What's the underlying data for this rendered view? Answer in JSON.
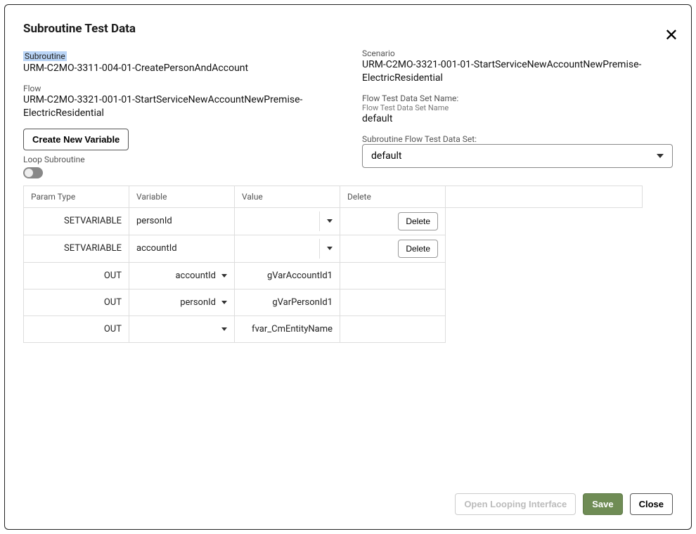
{
  "modal": {
    "title": "Subroutine Test Data",
    "close_icon": "✕"
  },
  "left": {
    "subroutine_label": "Subroutine",
    "subroutine_value": "URM-C2MO-3311-004-01-CreatePersonAndAccount",
    "flow_label": "Flow",
    "flow_value": "URM-C2MO-3321-001-01-StartServiceNewAccountNewPremise-ElectricResidential",
    "create_button": "Create New Variable",
    "loop_label": "Loop Subroutine"
  },
  "right": {
    "scenario_label": "Scenario",
    "scenario_value": "URM-C2MO-3321-001-01-StartServiceNewAccountNewPremise-ElectricResidential",
    "ftds_label": "Flow Test Data Set Name:",
    "ftds_sub_label": "Flow Test Data Set Name",
    "ftds_value": "default",
    "sftds_label": "Subroutine Flow Test Data Set:",
    "sftds_selected": "default"
  },
  "table": {
    "headers": {
      "param_type": "Param Type",
      "variable": "Variable",
      "value": "Value",
      "delete": "Delete"
    },
    "rows": [
      {
        "param_type": "SETVARIABLE",
        "variable": "personId",
        "variable_editable": false,
        "value": "",
        "value_dropdown": true,
        "delete_label": "Delete"
      },
      {
        "param_type": "SETVARIABLE",
        "variable": "accountId",
        "variable_editable": false,
        "value": "",
        "value_dropdown": true,
        "delete_label": "Delete"
      },
      {
        "param_type": "OUT",
        "variable": "accountId",
        "variable_editable": true,
        "value": "gVarAccountId1",
        "value_dropdown": false,
        "delete_label": ""
      },
      {
        "param_type": "OUT",
        "variable": "personId",
        "variable_editable": true,
        "value": "gVarPersonId1",
        "value_dropdown": false,
        "delete_label": ""
      },
      {
        "param_type": "OUT",
        "variable": "",
        "variable_editable": true,
        "value": "fvar_CmEntityName",
        "value_dropdown": false,
        "delete_label": ""
      }
    ]
  },
  "footer": {
    "open_looping": "Open Looping Interface",
    "save": "Save",
    "close": "Close"
  }
}
